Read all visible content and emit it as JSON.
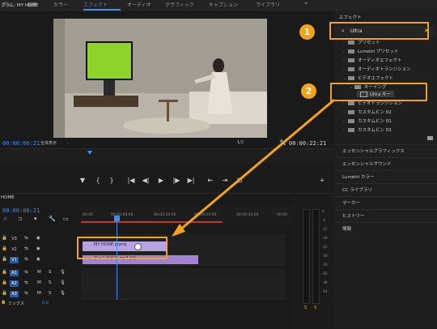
{
  "workspace_tabs": [
    {
      "label": "ブリ",
      "active": false
    },
    {
      "label": "編集",
      "active": false
    },
    {
      "label": "カラー",
      "active": false
    },
    {
      "label": "エフェクト",
      "active": true
    },
    {
      "label": "オーディオ",
      "active": false
    },
    {
      "label": "グラフィック",
      "active": false
    },
    {
      "label": "キャプション",
      "active": false
    },
    {
      "label": "ライブラリ",
      "active": false
    },
    {
      "label": "»",
      "active": false
    }
  ],
  "program_monitor": {
    "title": "グラム: MY HOME",
    "timecode_current": "00:00:06:21",
    "fit_label": "全体表示",
    "resolution": "1/2",
    "timecode_duration": "00:00:22:21"
  },
  "transport": {
    "buttons": [
      "▼",
      "{",
      "}",
      "|◀",
      "◀|",
      "▶",
      "|▶",
      "▶|",
      "⇤",
      "⇥",
      "⊡",
      "+"
    ]
  },
  "timeline": {
    "title": "HOME",
    "timecode": "00:00:06:21",
    "ruler_labels": [
      "00:00",
      "00:00:08:00",
      "00:00:16:00",
      "00:00:24:00",
      "00:00:32:00",
      "00:00"
    ],
    "tracks": [
      {
        "label": "V3",
        "kind": "video",
        "selected": false
      },
      {
        "label": "V2",
        "kind": "video",
        "selected": false
      },
      {
        "label": "V1",
        "kind": "video",
        "selected": true
      },
      {
        "label": "A1",
        "kind": "audio",
        "selected": true
      },
      {
        "label": "A2",
        "kind": "audio",
        "selected": true
      },
      {
        "label": "A3",
        "kind": "audio",
        "selected": true
      }
    ],
    "mix_label": "ミックス",
    "mix_value": "0.0",
    "clip_v2_label": "MY HOME.prproj",
    "clip_v1_label": "ホームビデオ.mp4 [V]"
  },
  "meters": {
    "db_labels": [
      "0",
      "-6",
      "-12",
      "-18",
      "-24",
      "-30",
      "-36",
      "-42",
      "-48",
      "-54"
    ],
    "footer": [
      "S",
      "S"
    ]
  },
  "effects_panel": {
    "title": "エフェクト",
    "search_value": "Ultra",
    "tree": [
      {
        "label": "プリセット",
        "depth": 0,
        "type": "folder"
      },
      {
        "label": "Lumetri プリセット",
        "depth": 0,
        "type": "folder"
      },
      {
        "label": "オーディオエフェクト",
        "depth": 0,
        "type": "folder"
      },
      {
        "label": "オーディオトランジション",
        "depth": 0,
        "type": "folder"
      },
      {
        "label": "ビデオエフェクト",
        "depth": 0,
        "type": "folder"
      },
      {
        "label": "キーイング",
        "depth": 1,
        "type": "folder"
      },
      {
        "label": "Ultra キー",
        "depth": 2,
        "type": "effect"
      },
      {
        "label": "ビデオトランジション",
        "depth": 0,
        "type": "folder"
      },
      {
        "label": "カスタムビン 02",
        "depth": 0,
        "type": "folder"
      },
      {
        "label": "カスタムビン 01",
        "depth": 0,
        "type": "folder"
      },
      {
        "label": "カスタムビン 02",
        "depth": 0,
        "type": "folder"
      }
    ],
    "bottom_panels": [
      "エッセンシャルグラフィックス",
      "エッセンシャルサウンド",
      "Lumetri カラー",
      "CC ライブラリ",
      "マーカー",
      "ヒストリー",
      "情報"
    ]
  },
  "annotations": {
    "badge_1": "1",
    "badge_2": "2"
  },
  "colors": {
    "accent": "#3f8ef0",
    "annotation": "#f2a31b",
    "clip": "#b7a3e0",
    "green_screen": "#8fd32a"
  }
}
